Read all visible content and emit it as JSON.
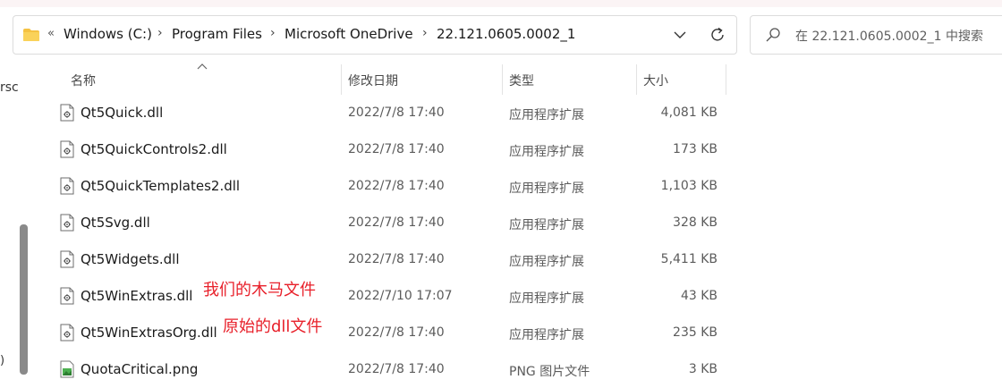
{
  "address_bar": {
    "overflow": "«",
    "crumbs": [
      "Windows (C:)",
      "Program Files",
      "Microsoft OneDrive",
      "22.121.0605.0002_1"
    ],
    "separator": "›"
  },
  "search": {
    "placeholder": "在 22.121.0605.0002_1 中搜索"
  },
  "left_pane": {
    "clipped_text": "rsc",
    "clipped_bottom": ")"
  },
  "columns": {
    "name": "名称",
    "date": "修改日期",
    "type": "类型",
    "size": "大小"
  },
  "files": [
    {
      "name": "Qt5Quick.dll",
      "date": "2022/7/8 17:40",
      "type": "应用程序扩展",
      "size": "4,081 KB",
      "icon": "dll-file-icon"
    },
    {
      "name": "Qt5QuickControls2.dll",
      "date": "2022/7/8 17:40",
      "type": "应用程序扩展",
      "size": "173 KB",
      "icon": "dll-file-icon"
    },
    {
      "name": "Qt5QuickTemplates2.dll",
      "date": "2022/7/8 17:40",
      "type": "应用程序扩展",
      "size": "1,103 KB",
      "icon": "dll-file-icon"
    },
    {
      "name": "Qt5Svg.dll",
      "date": "2022/7/8 17:40",
      "type": "应用程序扩展",
      "size": "328 KB",
      "icon": "dll-file-icon"
    },
    {
      "name": "Qt5Widgets.dll",
      "date": "2022/7/8 17:40",
      "type": "应用程序扩展",
      "size": "5,411 KB",
      "icon": "dll-file-icon"
    },
    {
      "name": "Qt5WinExtras.dll",
      "date": "2022/7/10 17:07",
      "type": "应用程序扩展",
      "size": "43 KB",
      "icon": "dll-file-icon"
    },
    {
      "name": "Qt5WinExtrasOrg.dll",
      "date": "2022/7/8 17:40",
      "type": "应用程序扩展",
      "size": "235 KB",
      "icon": "dll-file-icon"
    },
    {
      "name": "QuotaCritical.png",
      "date": "2022/7/8 17:40",
      "type": "PNG 图片文件",
      "size": "3 KB",
      "icon": "png-file-icon"
    }
  ],
  "annotations": {
    "trojan": "我们的木马文件",
    "original": "原始的dll文件"
  },
  "colors": {
    "annotation": "#e8202a",
    "folder": "#f5c242"
  }
}
